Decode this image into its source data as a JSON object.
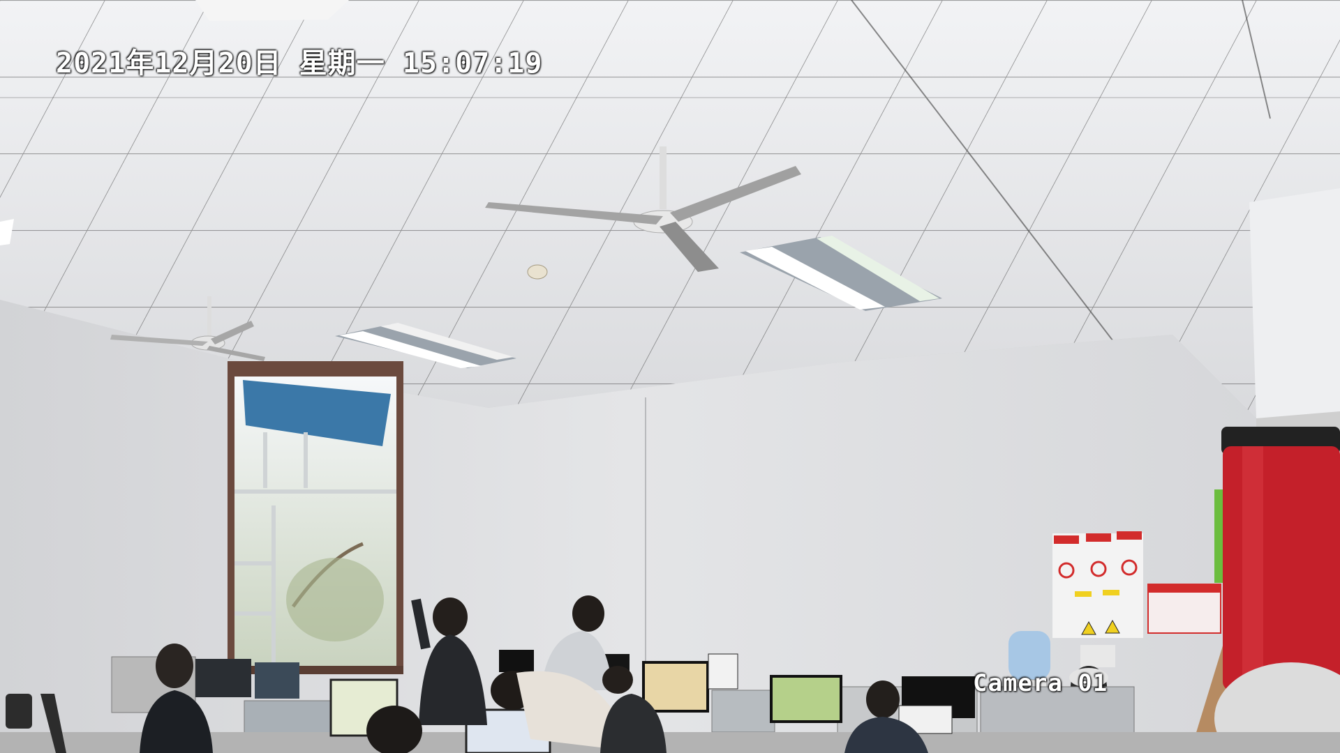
{
  "overlay": {
    "timestamp": "2021年12月20日 星期一 15:07:19",
    "camera_label": "Camera 01"
  },
  "colors": {
    "ceiling": "#e9eaec",
    "wall": "#dfe0e2",
    "window_frame": "#6b4a3e",
    "blind": "#3b78a8",
    "extinguisher_red": "#c4202a",
    "bin_green": "#6bbd3e",
    "sign_red": "#d22b2b"
  }
}
